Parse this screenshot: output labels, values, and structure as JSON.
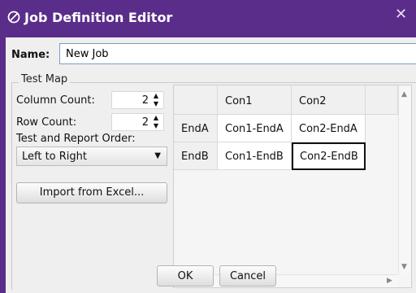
{
  "window": {
    "title": "Job Definition Editor",
    "close_glyph": "✕",
    "accent_color": "#5a2d8a"
  },
  "name": {
    "label": "Name:",
    "value": "New Job"
  },
  "test_map": {
    "legend": "Test Map",
    "column_count": {
      "label": "Column Count:",
      "value": "2"
    },
    "row_count": {
      "label": "Row Count:",
      "value": "2"
    },
    "order": {
      "label": "Test and Report Order:",
      "selected": "Left to Right"
    },
    "import_label": "Import from Excel..."
  },
  "grid": {
    "columns": [
      "Con1",
      "Con2"
    ],
    "rows": [
      {
        "header": "EndA",
        "cells": [
          "Con1-EndA",
          "Con2-EndA"
        ]
      },
      {
        "header": "EndB",
        "cells": [
          "Con1-EndB",
          "Con2-EndB"
        ]
      }
    ]
  },
  "buttons": {
    "ok": "OK",
    "cancel": "Cancel"
  }
}
